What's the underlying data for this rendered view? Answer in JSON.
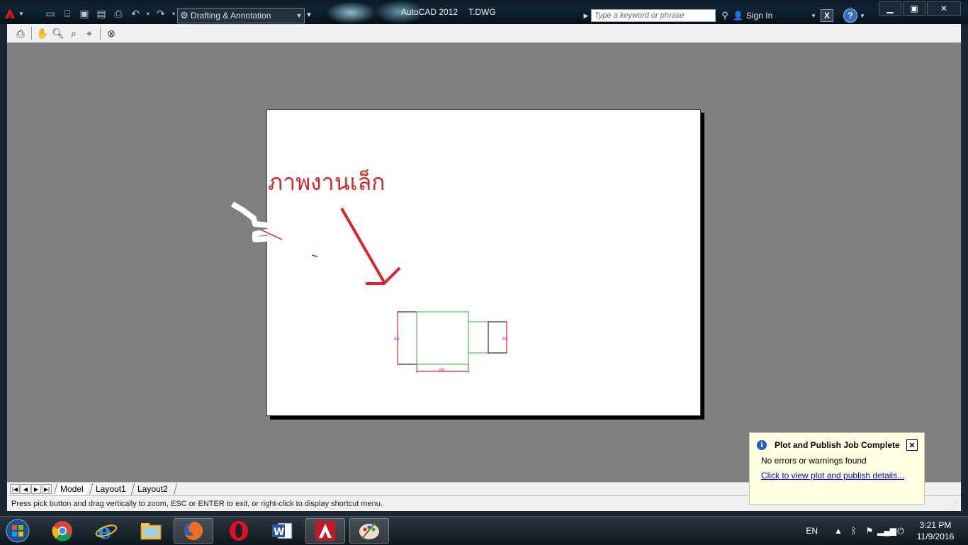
{
  "titlebar": {
    "app_title": "AutoCAD 2012",
    "file_name": "T.DWG",
    "workspace": "Drafting & Annotation",
    "search_placeholder": "Type a keyword or phrase",
    "sign_in": "Sign In"
  },
  "drawing": {
    "annotation_text": "ภาพงานเล็ก",
    "annotation_color": "#d9252b"
  },
  "layout_tabs": [
    {
      "label": "Model"
    },
    {
      "label": "Layout1"
    },
    {
      "label": "Layout2"
    }
  ],
  "status": {
    "prompt": "Press pick button and drag vertically to zoom, ESC or ENTER to exit, or right-click to display shortcut menu."
  },
  "notification": {
    "title": "Plot and Publish Job Complete",
    "message": "No errors or warnings found",
    "link": "Click to view plot and publish details..."
  },
  "tray": {
    "language": "EN",
    "time": "3:21 PM",
    "date": "11/9/2016"
  },
  "taskbar_apps": [
    "start-orb",
    "chrome",
    "internet-explorer",
    "file-explorer",
    "firefox",
    "opera",
    "word",
    "autocad",
    "paint"
  ]
}
